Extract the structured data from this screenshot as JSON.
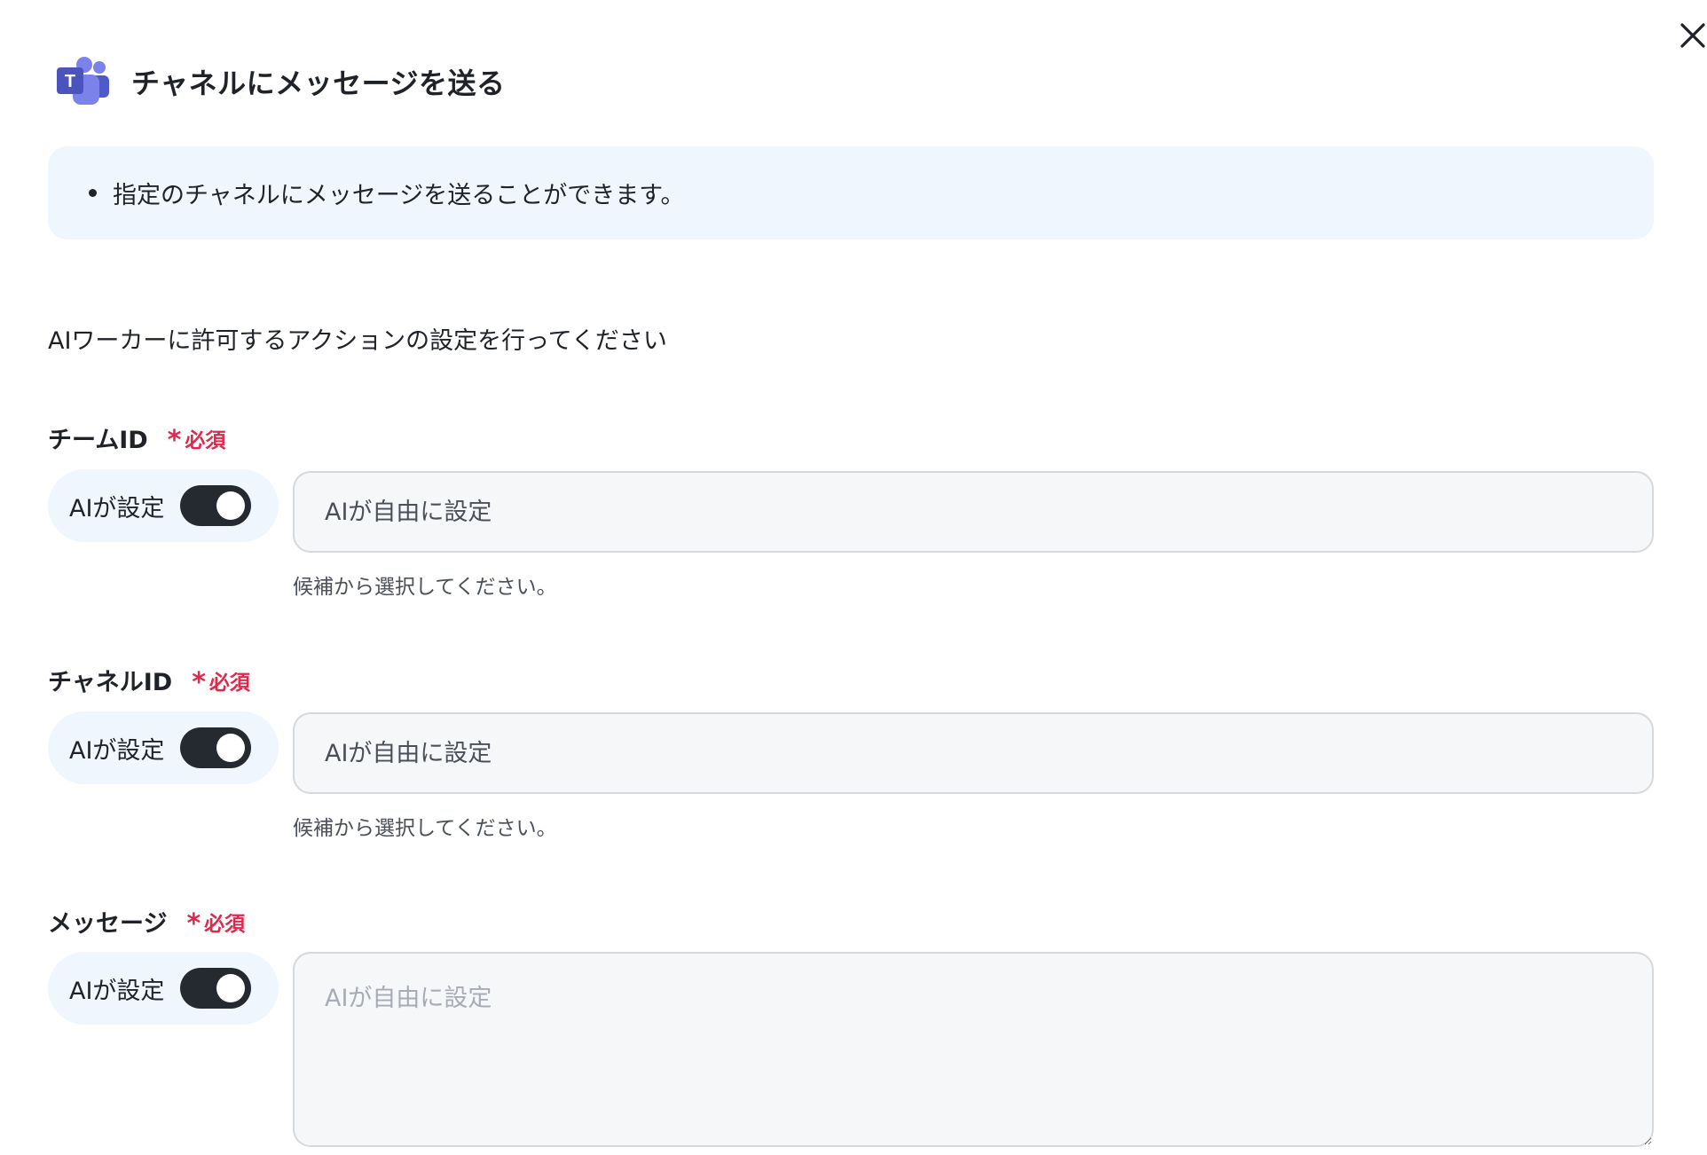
{
  "header": {
    "title": "チャネルにメッセージを送る",
    "app_icon": "microsoft-teams-icon",
    "close_icon": "close-icon"
  },
  "info": {
    "items": [
      "指定のチャネルにメッセージを送ることができます。"
    ]
  },
  "instruction": "AIワーカーに許可するアクションの設定を行ってください",
  "fields": [
    {
      "label": "チームID",
      "required_label": "必須",
      "toggle_label": "AIが設定",
      "toggle_on": true,
      "placeholder": "AIが自由に設定",
      "hint": "候補から選択してください。"
    },
    {
      "label": "チャネルID",
      "required_label": "必須",
      "toggle_label": "AIが設定",
      "toggle_on": true,
      "placeholder": "AIが自由に設定",
      "hint": "候補から選択してください。"
    },
    {
      "label": "メッセージ",
      "required_label": "必須",
      "toggle_label": "AIが設定",
      "toggle_on": true,
      "placeholder": "AIが自由に設定"
    }
  ],
  "colors": {
    "required": "#e0294a",
    "toggle_on": "#252a31",
    "info_bg": "#eff6fe",
    "input_bg": "#f6f7f9",
    "teams_brand": "#5059c9"
  }
}
